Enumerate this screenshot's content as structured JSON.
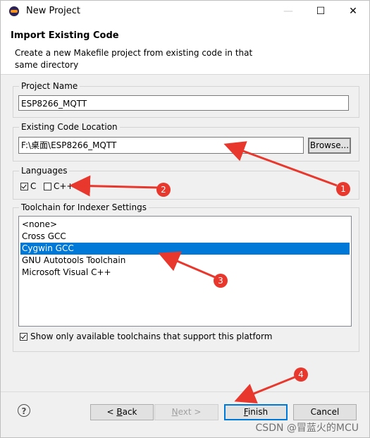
{
  "window": {
    "title": "New Project",
    "controls": {
      "minimize": "—",
      "maximize": "☐",
      "close": "✕"
    }
  },
  "header": {
    "title": "Import Existing Code",
    "description": "Create a new Makefile project from existing code in that same directory"
  },
  "project_name": {
    "label": "Project Name",
    "value": "ESP8266_MQTT"
  },
  "code_location": {
    "label": "Existing Code Location",
    "value": "F:\\桌面\\ESP8266_MQTT",
    "browse_label": "Browse..."
  },
  "languages": {
    "label": "Languages",
    "items": [
      {
        "label": "C",
        "checked": true
      },
      {
        "label": "C++",
        "checked": false
      }
    ]
  },
  "toolchain": {
    "label": "Toolchain for Indexer Settings",
    "items": [
      "<none>",
      "Cross GCC",
      "Cygwin GCC",
      "GNU Autotools Toolchain",
      "Microsoft Visual C++"
    ],
    "selected": "Cygwin GCC",
    "show_only_label": "Show only available toolchains that support this platform"
  },
  "buttons": {
    "help": "?",
    "back_prefix": "< ",
    "back_key": "B",
    "back_rest": "ack",
    "next_key": "N",
    "next_rest": "ext >",
    "finish_key": "F",
    "finish_rest": "inish",
    "cancel": "Cancel"
  },
  "annotations": {
    "badges": [
      "1",
      "2",
      "3",
      "4"
    ],
    "arrow_color": "#e8372c"
  },
  "watermark": "CSDN @冒蓝火的MCU"
}
